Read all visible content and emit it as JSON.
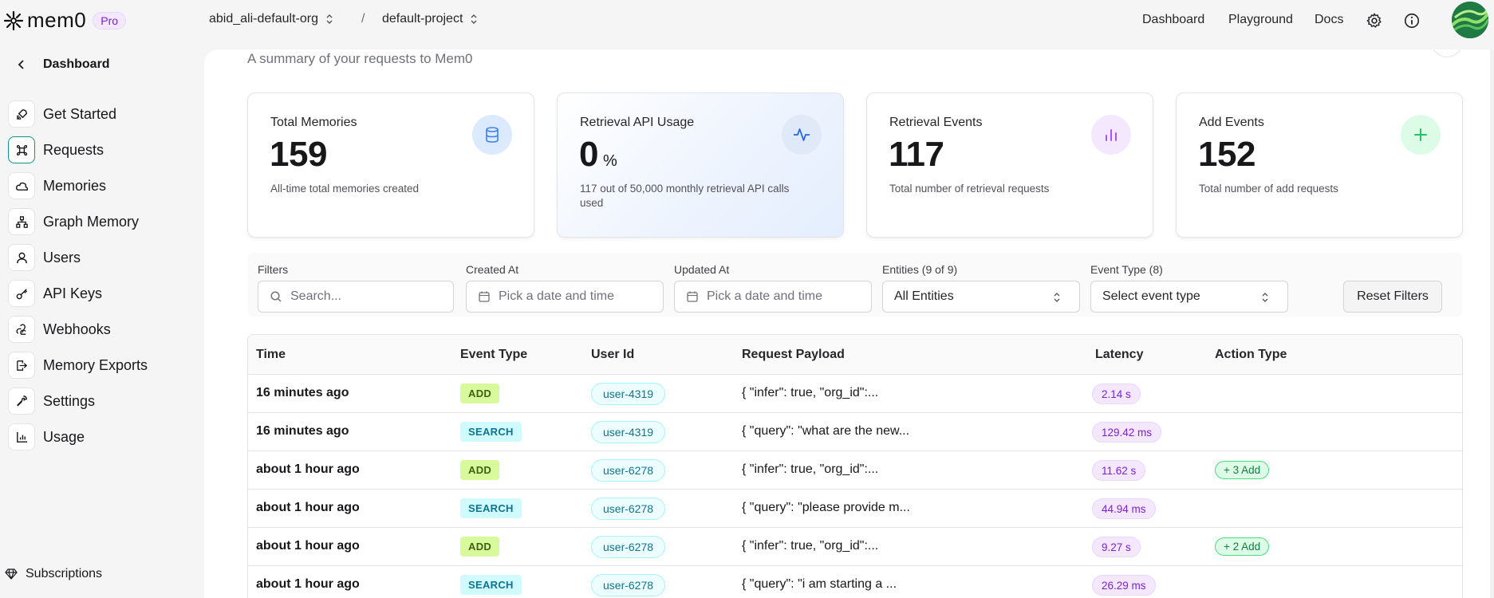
{
  "brand": {
    "name": "mem0",
    "plan": "Pro"
  },
  "header": {
    "org": "abid_ali-default-org",
    "separator": "/",
    "project": "default-project",
    "links": [
      "Dashboard",
      "Playground",
      "Docs"
    ]
  },
  "sidebar": {
    "back_label": "Dashboard",
    "items": [
      {
        "label": "Get Started",
        "icon": "rocket-icon"
      },
      {
        "label": "Requests",
        "icon": "command-icon"
      },
      {
        "label": "Memories",
        "icon": "cloud-icon"
      },
      {
        "label": "Graph Memory",
        "icon": "network-icon"
      },
      {
        "label": "Users",
        "icon": "user-icon"
      },
      {
        "label": "API Keys",
        "icon": "key-icon"
      },
      {
        "label": "Webhooks",
        "icon": "webhook-icon"
      },
      {
        "label": "Memory Exports",
        "icon": "export-icon"
      },
      {
        "label": "Settings",
        "icon": "wrench-icon"
      },
      {
        "label": "Usage",
        "icon": "chart-icon"
      }
    ],
    "active_item": "Requests",
    "subscriptions_label": "Subscriptions"
  },
  "page": {
    "subtitle": "A summary of your requests to Mem0"
  },
  "cards": [
    {
      "title": "Total Memories",
      "value": "159",
      "unit": "",
      "desc": "All-time total memories created",
      "icon": "database-icon",
      "color": "#3b82f6"
    },
    {
      "title": "Retrieval API Usage",
      "value": "0",
      "unit": "%",
      "desc": "117 out of 50,000 monthly retrieval API calls used",
      "icon": "activity-icon",
      "color": "#2563eb"
    },
    {
      "title": "Retrieval Events",
      "value": "117",
      "unit": "",
      "desc": "Total number of retrieval requests",
      "icon": "bar-chart-icon",
      "color": "#a855f7"
    },
    {
      "title": "Add Events",
      "value": "152",
      "unit": "",
      "desc": "Total number of add requests",
      "icon": "plus-icon",
      "color": "#22c55e"
    }
  ],
  "filters": {
    "filters_label": "Filters",
    "search_placeholder": "Search...",
    "created_label": "Created At",
    "created_placeholder": "Pick a date and time",
    "updated_label": "Updated At",
    "updated_placeholder": "Pick a date and time",
    "entities_label": "Entities (9 of 9)",
    "entities_value": "All Entities",
    "event_type_label": "Event Type (8)",
    "event_type_value": "Select event type",
    "reset_label": "Reset Filters"
  },
  "table": {
    "columns": [
      "Time",
      "Event Type",
      "User Id",
      "Request Payload",
      "Latency",
      "Action Type"
    ],
    "rows": [
      {
        "time": "16 minutes ago",
        "event": "ADD",
        "user": "user-4319",
        "payload": "{ \"infer\": true, \"org_id\":...",
        "latency": "2.14 s",
        "action": ""
      },
      {
        "time": "16 minutes ago",
        "event": "SEARCH",
        "user": "user-4319",
        "payload": "{ \"query\": \"what are the new...",
        "latency": "129.42 ms",
        "action": ""
      },
      {
        "time": "about 1 hour ago",
        "event": "ADD",
        "user": "user-6278",
        "payload": "{ \"infer\": true, \"org_id\":...",
        "latency": "11.62 s",
        "action": "+ 3 Add"
      },
      {
        "time": "about 1 hour ago",
        "event": "SEARCH",
        "user": "user-6278",
        "payload": "{ \"query\": \"please provide m...",
        "latency": "44.94 ms",
        "action": ""
      },
      {
        "time": "about 1 hour ago",
        "event": "ADD",
        "user": "user-6278",
        "payload": "{ \"infer\": true, \"org_id\":...",
        "latency": "9.27 s",
        "action": "+ 2 Add"
      },
      {
        "time": "about 1 hour ago",
        "event": "SEARCH",
        "user": "user-6278",
        "payload": "{ \"query\": \"i am starting a ...",
        "latency": "26.29 ms",
        "action": ""
      }
    ]
  }
}
